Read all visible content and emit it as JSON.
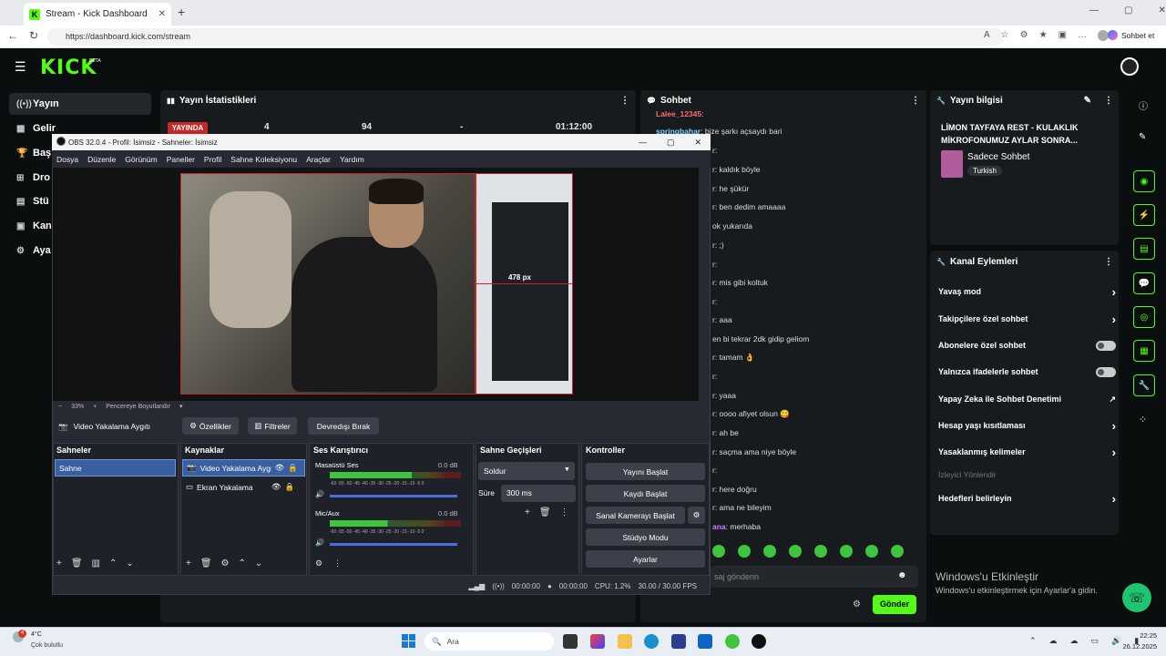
{
  "browser": {
    "tab_title": "Stream - Kick Dashboard",
    "url": "https://dashboard.kick.com/stream",
    "copilot_label": "Sohbet et"
  },
  "kick": {
    "logo": "KICK",
    "beta": "BETA",
    "sidebar": [
      {
        "label": "Yayın",
        "icon": "broadcast-icon"
      },
      {
        "label": "Gelir",
        "icon": "revenue-icon"
      },
      {
        "label": "Baş",
        "icon": "trophy-icon"
      },
      {
        "label": "Dro",
        "icon": "drops-icon"
      },
      {
        "label": "Stü",
        "icon": "studio-icon"
      },
      {
        "label": "Kan",
        "icon": "channel-icon"
      },
      {
        "label": "Aya",
        "icon": "settings-icon"
      }
    ],
    "stats": {
      "title": "Yayın İstatistikleri",
      "live_badge": "YAYINDA",
      "viewers": "4",
      "followers": "94",
      "dash": "-",
      "duration": "01:12:00"
    },
    "chat": {
      "title": "Sohbet",
      "lines": [
        {
          "user": "Lalee_12345",
          "text": ":"
        },
        {
          "user": "springbahar",
          "text": ": bize şarkı açsaydı bari"
        },
        {
          "user": "",
          "text": "r:"
        },
        {
          "user": "",
          "text": "r: kaldık böyle"
        },
        {
          "user": "",
          "text": "r: he şükür"
        },
        {
          "user": "",
          "text": "r: ben dedim amaaaa"
        },
        {
          "user": "",
          "text": "ok yukarıda"
        },
        {
          "user": "",
          "text": "r: ;)"
        },
        {
          "user": "",
          "text": "r:"
        },
        {
          "user": "",
          "text": "r: mis gibi koltuk"
        },
        {
          "user": "",
          "text": "r:"
        },
        {
          "user": "",
          "text": "r: aaa"
        },
        {
          "user": "",
          "text": "en bi tekrar 2dk gidip geliom"
        },
        {
          "user": "",
          "text": "r: tamam 👌"
        },
        {
          "user": "",
          "text": "r:"
        },
        {
          "user": "",
          "text": "r: yaaa"
        },
        {
          "user": "",
          "text": "r: oooo afiyet olsun 😋"
        },
        {
          "user": "",
          "text": "r: ah be"
        },
        {
          "user": "",
          "text": "r: saçma ama niye böyle"
        },
        {
          "user": "",
          "text": "r:"
        },
        {
          "user": "",
          "text": "r: here doğru"
        },
        {
          "user": "",
          "text": "r: ama ne bileyim"
        },
        {
          "user": "ana",
          "text": ": merhaba"
        }
      ],
      "input_placeholder": "saj gönderin",
      "send_label": "Gönder"
    },
    "stream_info": {
      "title": "Yayın bilgisi",
      "stream_title": "LİMON TAYFAYA REST - KULAKLIK MİKROFONUMUZ AYLAR SONRA...",
      "category": "Sadece Sohbet",
      "tag": "Turkish"
    },
    "channel_actions": {
      "title": "Kanal Eylemleri",
      "items": [
        {
          "label": "Yavaş mod",
          "control": "chevron"
        },
        {
          "label": "Takipçilere özel sohbet",
          "control": "chevron"
        },
        {
          "label": "Abonelere özel sohbet",
          "control": "toggle"
        },
        {
          "label": "Yalnızca ifadelerle sohbet",
          "control": "toggle"
        },
        {
          "label": "Yapay Zeka ile Sohbet Denetimi",
          "control": "external"
        },
        {
          "label": "Hesap yaşı kısıtlaması",
          "control": "chevron"
        },
        {
          "label": "Yasaklanmış kelimeler",
          "control": "chevron"
        }
      ],
      "section_label": "İzleyici Yönlendir",
      "goals_label": "Hedefleri belirleyin"
    },
    "watermark": {
      "line1": "Windows'u Etkinleştir",
      "line2": "Windows'u etkinleştirmek için Ayarlar'a gidin."
    }
  },
  "obs": {
    "title": "OBS 32.0.4 - Profil: İsimsiz - Sahneler: İsimsiz",
    "menu": [
      "Dosya",
      "Düzenle",
      "Görünüm",
      "Paneller",
      "Profil",
      "Sahne Koleksiyonu",
      "Araçlar",
      "Yardım"
    ],
    "size_label": "478 px",
    "zoom": "33%",
    "fit_label": "Pencereye Boyutlandır",
    "source_name": "Video Yakalama Aygıtı",
    "btn_properties": "Özellikler",
    "btn_filters": "Filtreler",
    "btn_deactivate": "Devredışı Bırak",
    "docks": {
      "scenes": "Sahneler",
      "sources": "Kaynaklar",
      "mixer": "Ses Karıştırıcı",
      "transitions": "Sahne Geçişleri",
      "controls": "Kontroller"
    },
    "scene_item": "Sahne",
    "sources_list": [
      "Video Yakalama Aygıtı",
      "Ekran Yakalama"
    ],
    "mixer": [
      {
        "name": "Masaüstü Ses",
        "db": "0.0 dB",
        "level": 0.78
      },
      {
        "name": "Mic/Aux",
        "db": "0.0 dB",
        "level": 0.55
      }
    ],
    "meter_scale": "-60 -55 -50 -45 -40 -35 -30 -25 -20 -15 -10 -5 0",
    "transition": "Soldur",
    "duration_label": "Süre",
    "duration_value": "300 ms",
    "controls": [
      "Yayını Başlat",
      "Kaydı Başlat",
      "Sanal Kamerayı Başlat",
      "Stüdyo Modu",
      "Ayarlar"
    ],
    "status": {
      "stream_time": "00:00:00",
      "rec_time": "00:00:00",
      "cpu": "CPU: 1.2%",
      "fps": "30.00 / 30.00 FPS"
    }
  },
  "taskbar": {
    "weather_temp": "4°C",
    "weather_desc": "Çok bulutlu",
    "search": "Ara",
    "time": "22:25",
    "date": "26.12.2025",
    "notif_count": "4"
  }
}
